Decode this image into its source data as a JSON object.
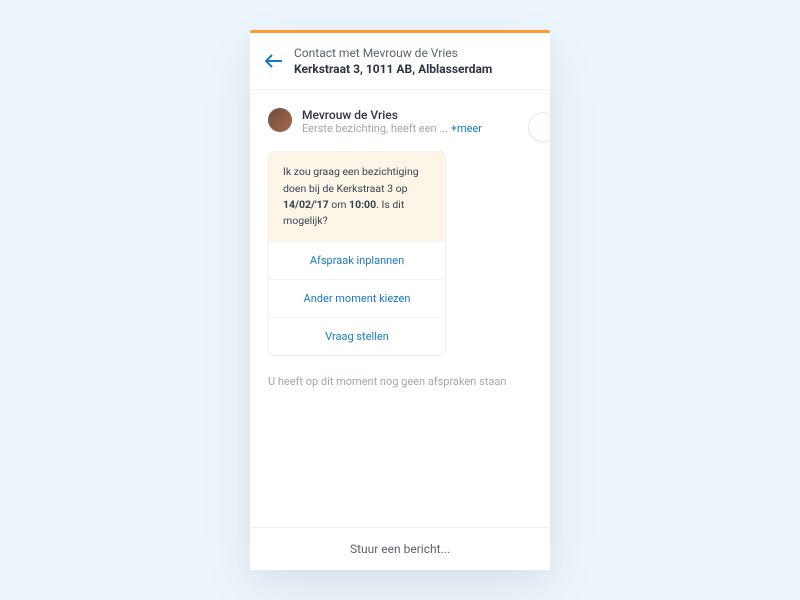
{
  "header": {
    "title": "Contact met Mevrouw de Vries",
    "subtitle": "Kerkstraat 3, 1011 AB, Alblasserdam"
  },
  "contact": {
    "name": "Mevrouw de Vries",
    "preview": "Eerste bezichting, heeft een ...",
    "more": "+meer"
  },
  "message": {
    "text_pre": "Ik zou graag een bezichtiging doen bij de Kerkstraat 3 op ",
    "date": "14/02/'17",
    "text_mid": " om ",
    "time": "10:00",
    "text_post": ". Is dit mogelijk?"
  },
  "actions": {
    "schedule": "Afspraak inplannen",
    "other_time": "Ander moment kiezen",
    "ask": "Vraag stellen"
  },
  "status": "U heeft op dit moment nog geen afspraken staan",
  "input": {
    "placeholder": "Stuur een bericht..."
  }
}
